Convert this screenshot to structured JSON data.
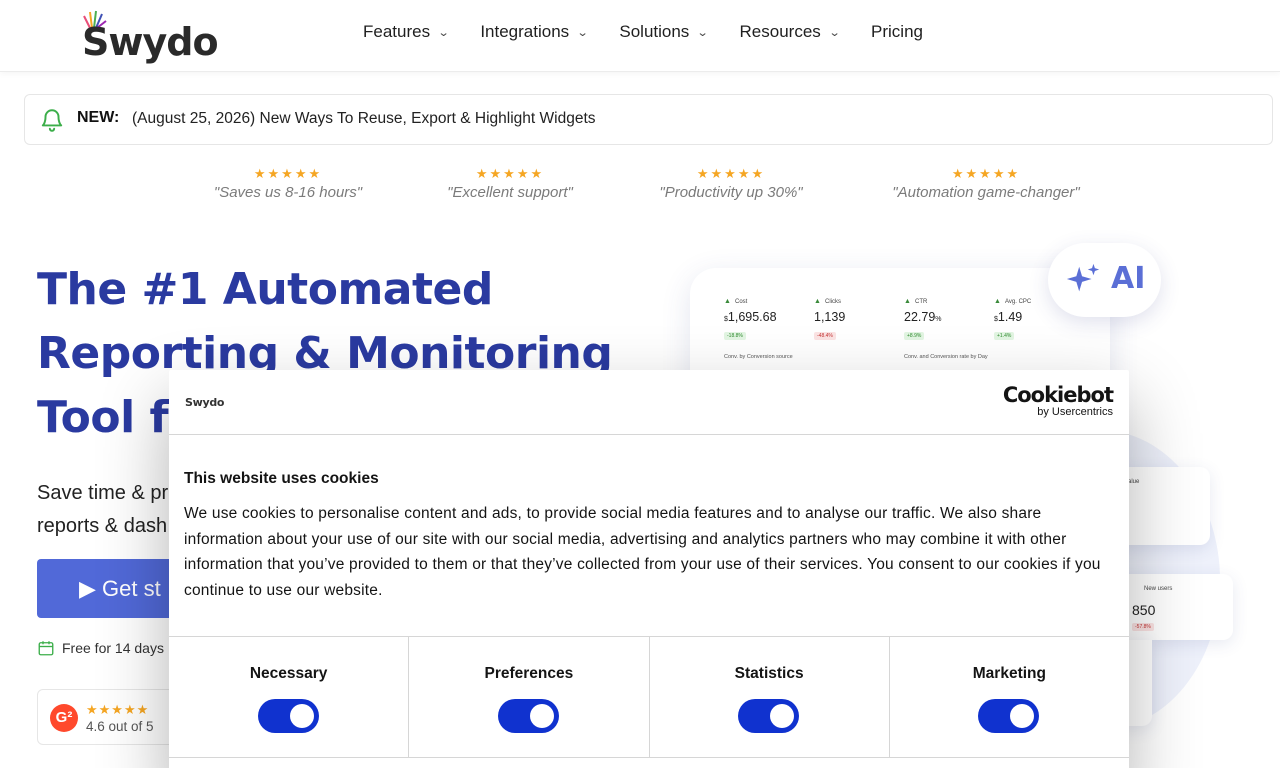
{
  "brand": {
    "name": "Swydo"
  },
  "nav": {
    "items": [
      {
        "label": "Features",
        "has_menu": true
      },
      {
        "label": "Integrations",
        "has_menu": true
      },
      {
        "label": "Solutions",
        "has_menu": true
      },
      {
        "label": "Resources",
        "has_menu": true
      },
      {
        "label": "Pricing",
        "has_menu": false
      }
    ]
  },
  "announcement": {
    "tag": "NEW:",
    "text": "(August 25, 2026) New Ways To Reuse, Export & Highlight Widgets"
  },
  "reviews": [
    {
      "stars": "★★★★★",
      "quote": "\"Saves us 8-16 hours\""
    },
    {
      "stars": "★★★★★",
      "quote": "\"Excellent support\""
    },
    {
      "stars": "★★★★★",
      "quote": "\"Productivity up 30%\""
    },
    {
      "stars": "★★★★★",
      "quote": "\"Automation game-changer\""
    }
  ],
  "hero": {
    "title_line1": "The #1 Automated",
    "title_line2": "Reporting & Monitoring",
    "title_line3": "Tool fo",
    "subtitle_line1": "Save time & pr",
    "subtitle_line2": "reports & dash",
    "cta_label": "▶ Get st",
    "free_trial": "Free for 14 days",
    "g2_stars": "★★★★★",
    "g2_rating": "4.6 out of 5",
    "g2_logo": "G²"
  },
  "dashboard": {
    "kpis": [
      {
        "label": "Cost",
        "currency": "$",
        "value": "1,695.68",
        "delta": "-18.8%",
        "trend": "up"
      },
      {
        "label": "Clicks",
        "currency": "",
        "value": "1,139",
        "delta": "-48.4%",
        "trend": "down"
      },
      {
        "label": "CTR",
        "currency": "",
        "value": "22.79",
        "unit": "%",
        "delta": "+8.9%",
        "trend": "up"
      },
      {
        "label": "Avg. CPC",
        "currency": "$",
        "value": "1.49",
        "delta": "+1.4%",
        "trend": "up"
      }
    ],
    "sub_left": "Conv. by Conversion source",
    "sub_right": "Conv. and Conversion rate by Day",
    "side_card_top_label": "alue",
    "side_card_users_label": "New users",
    "side_card_users_value": "850",
    "side_card_users_delta": "-57.8%",
    "ai_label": "AI"
  },
  "cookie_dialog": {
    "site_logo": "Swydo",
    "provider_name": "Cookiebot",
    "provider_by": "by Usercentrics",
    "title": "This website uses cookies",
    "body": "We use cookies to personalise content and ads, to provide social media features and to analyse our traffic. We also share information about your use of our site with our social media, advertising and analytics partners who may combine it with other information that you’ve provided to them or that they’ve collected from your use of their services. You consent to our cookies if you continue to use our website.",
    "categories": [
      {
        "label": "Necessary",
        "enabled": true
      },
      {
        "label": "Preferences",
        "enabled": true
      },
      {
        "label": "Statistics",
        "enabled": true
      },
      {
        "label": "Marketing",
        "enabled": true
      }
    ],
    "toggle_color": "#1032cf"
  },
  "colors": {
    "hero_title": "#2a3aa0",
    "cta_bg": "#5169d8",
    "star": "#f5a623",
    "ai_accent": "#5b6fd6"
  }
}
